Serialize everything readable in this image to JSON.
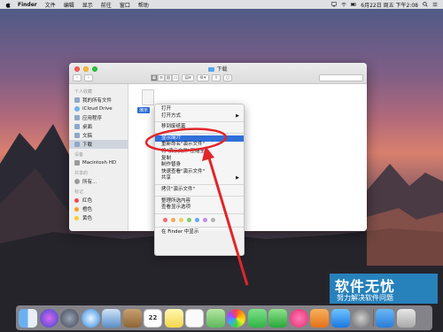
{
  "menubar": {
    "app": "Finder",
    "items": [
      "文件",
      "编辑",
      "显示",
      "前往",
      "窗口",
      "帮助"
    ],
    "datetime": "6月22日 周五 下午2:08"
  },
  "window": {
    "title": "下载"
  },
  "sidebar": {
    "favorites_header": "个人收藏",
    "favorites": [
      "我的所有文件",
      "iCloud Drive",
      "应用程序",
      "桌面",
      "文稿",
      "下载"
    ],
    "devices_header": "设备",
    "devices": [
      "Macintosh HD"
    ],
    "shared_header": "共享的",
    "shared": [
      "所有..."
    ],
    "tags_header": "标记",
    "tags": [
      {
        "label": "红色",
        "color": "#f24a4a"
      },
      {
        "label": "橙色",
        "color": "#f5a024"
      },
      {
        "label": "黄色",
        "color": "#f3d02a"
      }
    ]
  },
  "file": {
    "label": "演示"
  },
  "context_menu": {
    "items": [
      {
        "label": "打开"
      },
      {
        "label": "打开方式",
        "arrow": "▶"
      },
      {
        "label": "移到废纸篓"
      },
      {
        "label": "显示简介",
        "selected": true
      },
      {
        "label": "重新命名\"演示文件\""
      },
      {
        "label": "将\"演示文件\"压缩至..."
      },
      {
        "label": "复制"
      },
      {
        "label": "制作替身"
      },
      {
        "label": "快速查看\"演示文件\""
      },
      {
        "label": "共享",
        "arrow": "▶"
      },
      {
        "label": "拷贝\"演示文件\""
      },
      {
        "label": "整理所选内容"
      },
      {
        "label": "查看显示选项"
      },
      {
        "label": "在 Finder 中显示"
      }
    ],
    "tag_colors": [
      "#f26b6b",
      "#f5a95a",
      "#f0d064",
      "#7ccf6d",
      "#69a7ef",
      "#c48ae6",
      "#b3b3b3"
    ]
  },
  "watermark": {
    "title": "软件无忧",
    "subtitle": "努力解决软件问题"
  },
  "dock": {
    "calendar_day": "22"
  },
  "colors": {
    "selection_blue": "#2f6fd9",
    "annotation_red": "#e0262b"
  }
}
